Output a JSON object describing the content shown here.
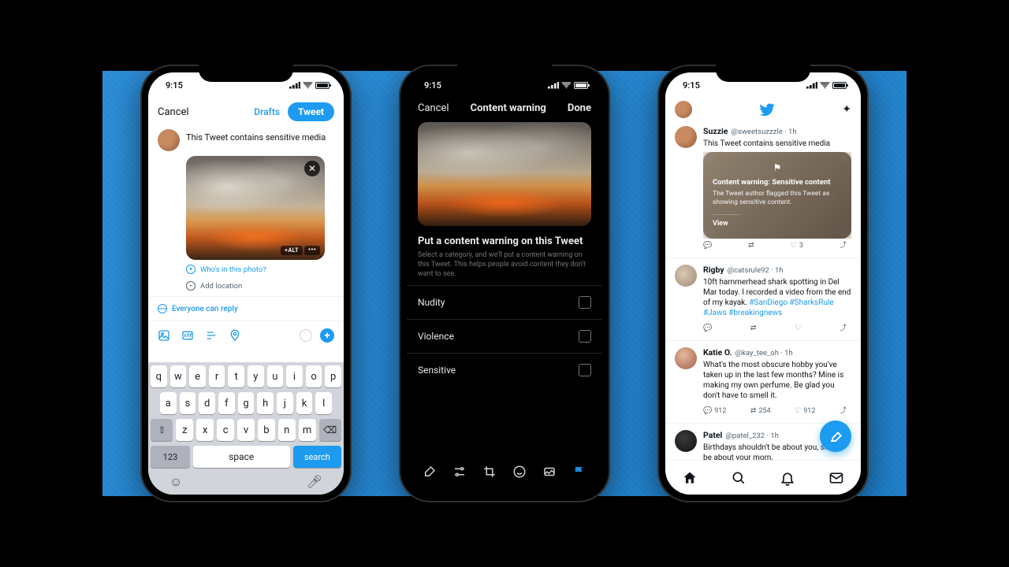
{
  "status_time": "9:15",
  "phone1": {
    "cancel": "Cancel",
    "drafts": "Drafts",
    "tweet": "Tweet",
    "text": "This Tweet contains sensitive media",
    "alt": "+ALT",
    "tag": "Who's in this photo?",
    "location": "Add location",
    "reply": "Everyone can reply",
    "keyboard": {
      "r1": [
        "q",
        "w",
        "e",
        "r",
        "t",
        "y",
        "u",
        "i",
        "o",
        "p"
      ],
      "r2": [
        "a",
        "s",
        "d",
        "f",
        "g",
        "h",
        "j",
        "k",
        "l"
      ],
      "r3_mid": [
        "z",
        "x",
        "c",
        "v",
        "b",
        "n",
        "m"
      ],
      "num": "123",
      "space": "space",
      "search": "search"
    }
  },
  "phone2": {
    "cancel": "Cancel",
    "title": "Content warning",
    "done": "Done",
    "heading": "Put a content warning on this Tweet",
    "sub": "Select a category, and we'll put a content warning on this Tweet. This helps people avoid content they don't want to see.",
    "options": [
      "Nudity",
      "Violence",
      "Sensitive"
    ]
  },
  "phone3": {
    "tweets": [
      {
        "name": "Suzzie",
        "handle": "@sweetsuzzzle · 1h",
        "text": "This Tweet contains sensitive media",
        "cw_title": "Content warning: Sensitive content",
        "cw_desc": "The Tweet author flagged this Tweet as showing sensitive content.",
        "cw_view": "View",
        "likes": "3"
      },
      {
        "name": "Rigby",
        "handle": "@catsrule92 · 1h",
        "text": "10ft hammerhead shark spotting in Del Mar today. I recorded a video from the end of my kayak.",
        "tags": " #SanDiego #SharksRule #Jaws #breakingnews"
      },
      {
        "name": "Katie O.",
        "handle": "@kay_tee_oh · 1h",
        "text": "What's the most obscure hobby you've taken up in the last few months? Mine is making my own perfume. Be glad you don't have to smell it.",
        "c": "912",
        "r": "254",
        "l": "912"
      },
      {
        "name": "Patel",
        "handle": "@patel_232 · 1h",
        "text": "Birthdays shouldn't be about you, should be about your mom."
      }
    ]
  }
}
